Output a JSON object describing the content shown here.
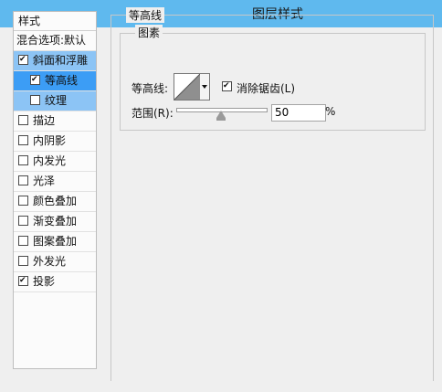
{
  "window": {
    "title": "图层样式"
  },
  "sidebar": {
    "header": "样式",
    "blending_options": "混合选项:默认",
    "items": [
      {
        "label": "斜面和浮雕",
        "checked": true,
        "selected": true
      },
      {
        "label": "等高线",
        "checked": true,
        "selected": true,
        "sub": true
      },
      {
        "label": "纹理",
        "checked": false,
        "sub": true
      },
      {
        "label": "描边",
        "checked": false
      },
      {
        "label": "内阴影",
        "checked": false
      },
      {
        "label": "内发光",
        "checked": false
      },
      {
        "label": "光泽",
        "checked": false
      },
      {
        "label": "颜色叠加",
        "checked": false
      },
      {
        "label": "渐变叠加",
        "checked": false
      },
      {
        "label": "图案叠加",
        "checked": false
      },
      {
        "label": "外发光",
        "checked": false
      },
      {
        "label": "投影",
        "checked": true
      }
    ]
  },
  "panel": {
    "group_title": "等高线",
    "subgroup_title": "图素",
    "contour_label": "等高线:",
    "anti_alias_label": "消除锯齿(L)",
    "anti_alias_checked": true,
    "range_label": "范围(R):",
    "range_value": "50",
    "range_unit": "%",
    "range_fraction": 0.5
  },
  "colors": {
    "titlebar": "#5fb9ee",
    "selected_row": "#8cc4f5",
    "selected_subrow": "#3c9df5"
  }
}
